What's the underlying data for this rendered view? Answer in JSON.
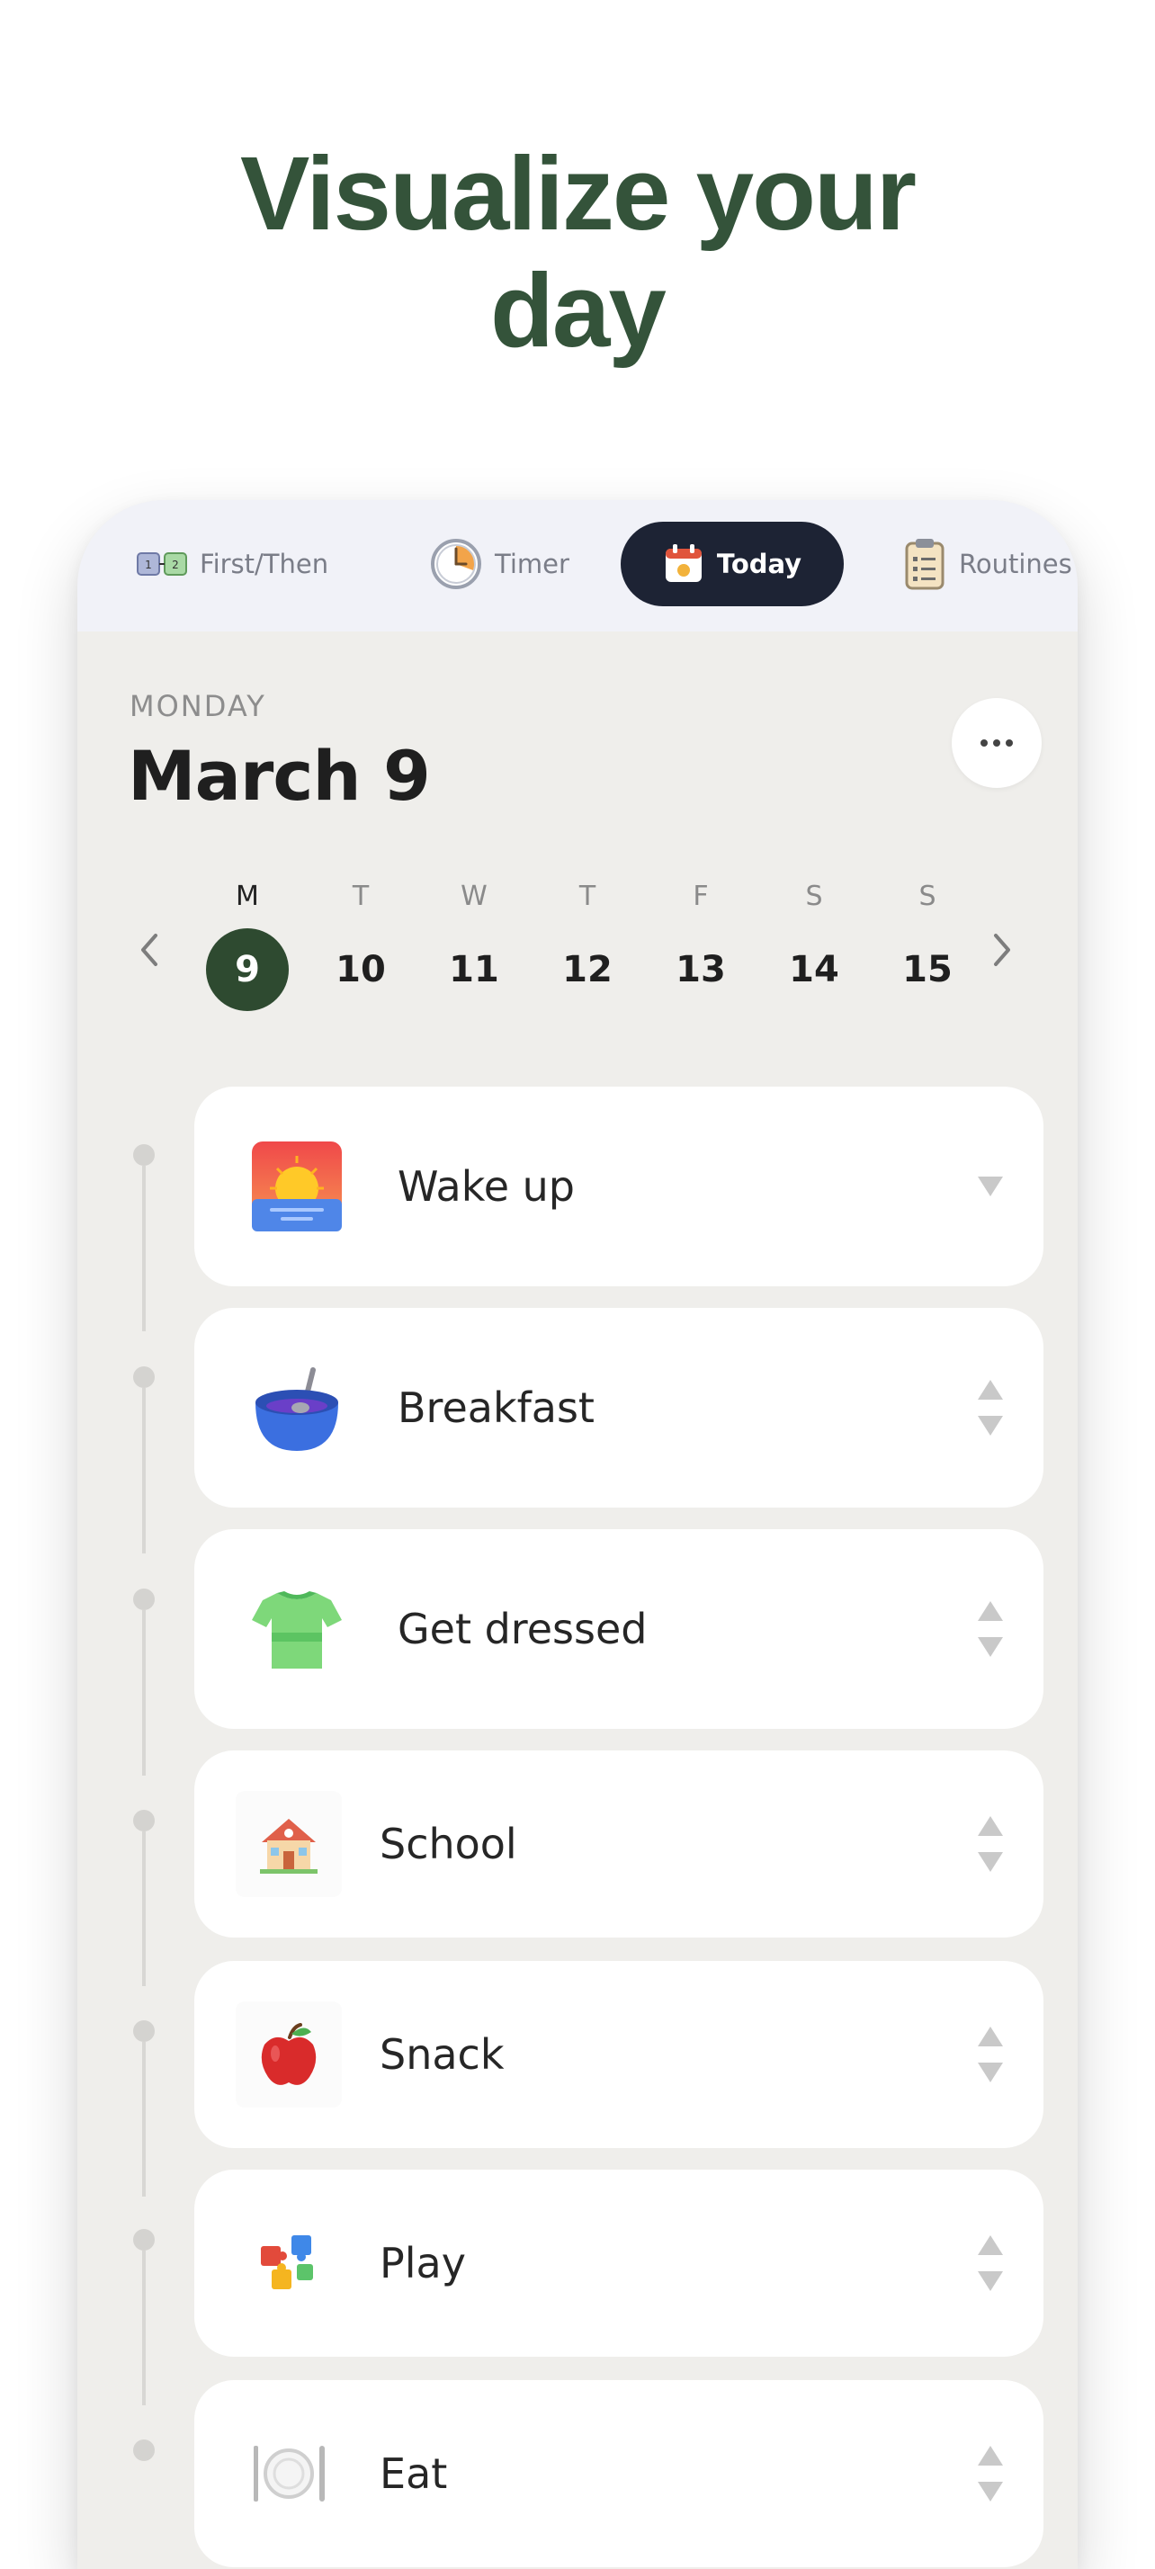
{
  "headline": {
    "line1": "Visualize your",
    "line2": "day"
  },
  "tabs": [
    {
      "label": "First/Then",
      "icon": "first-then-icon",
      "active": false
    },
    {
      "label": "Timer",
      "icon": "timer-icon",
      "active": false
    },
    {
      "label": "Today",
      "icon": "calendar-icon",
      "active": true
    },
    {
      "label": "Routines",
      "icon": "clipboard-icon",
      "active": false
    }
  ],
  "header": {
    "weekday": "MONDAY",
    "date": "March 9"
  },
  "week": {
    "days": [
      {
        "letter": "M",
        "num": "9",
        "selected": true
      },
      {
        "letter": "T",
        "num": "10",
        "selected": false
      },
      {
        "letter": "W",
        "num": "11",
        "selected": false
      },
      {
        "letter": "T",
        "num": "12",
        "selected": false
      },
      {
        "letter": "F",
        "num": "13",
        "selected": false
      },
      {
        "letter": "S",
        "num": "14",
        "selected": false
      },
      {
        "letter": "S",
        "num": "15",
        "selected": false
      }
    ]
  },
  "activities": [
    {
      "label": "Wake up",
      "icon": "sunrise-icon"
    },
    {
      "label": "Breakfast",
      "icon": "cereal-bowl-icon"
    },
    {
      "label": "Get dressed",
      "icon": "t-shirt-icon"
    },
    {
      "label": "School",
      "icon": "school-house-icon"
    },
    {
      "label": "Snack",
      "icon": "apple-icon"
    },
    {
      "label": "Play",
      "icon": "puzzle-pieces-icon"
    },
    {
      "label": "Eat",
      "icon": "plate-cutlery-icon"
    }
  ],
  "colors": {
    "headline": "#34533a",
    "selected_day": "#2e4a30",
    "active_tab": "#1d2334",
    "screen_bg": "#efeeeb"
  }
}
